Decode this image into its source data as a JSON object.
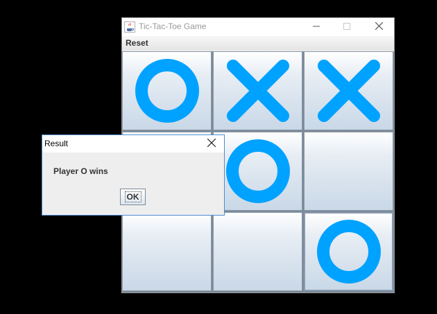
{
  "window": {
    "title": "Tic-Tac-Toe Game",
    "app_icon": "java-coffee-icon",
    "controls": [
      "minimize-icon",
      "maximize-icon",
      "close-icon"
    ]
  },
  "menu": {
    "reset_label": "Reset"
  },
  "board": {
    "cells": [
      "O",
      "X",
      "X",
      "",
      "O",
      "",
      "",
      "",
      "O"
    ],
    "mark_color": "#00a2ff"
  },
  "dialog": {
    "title": "Result",
    "message": "Player O wins",
    "ok_label": "OK"
  },
  "colors": {
    "mark": "#00a2ff",
    "dialog_border": "#4d8bd1",
    "background": "#000000"
  }
}
